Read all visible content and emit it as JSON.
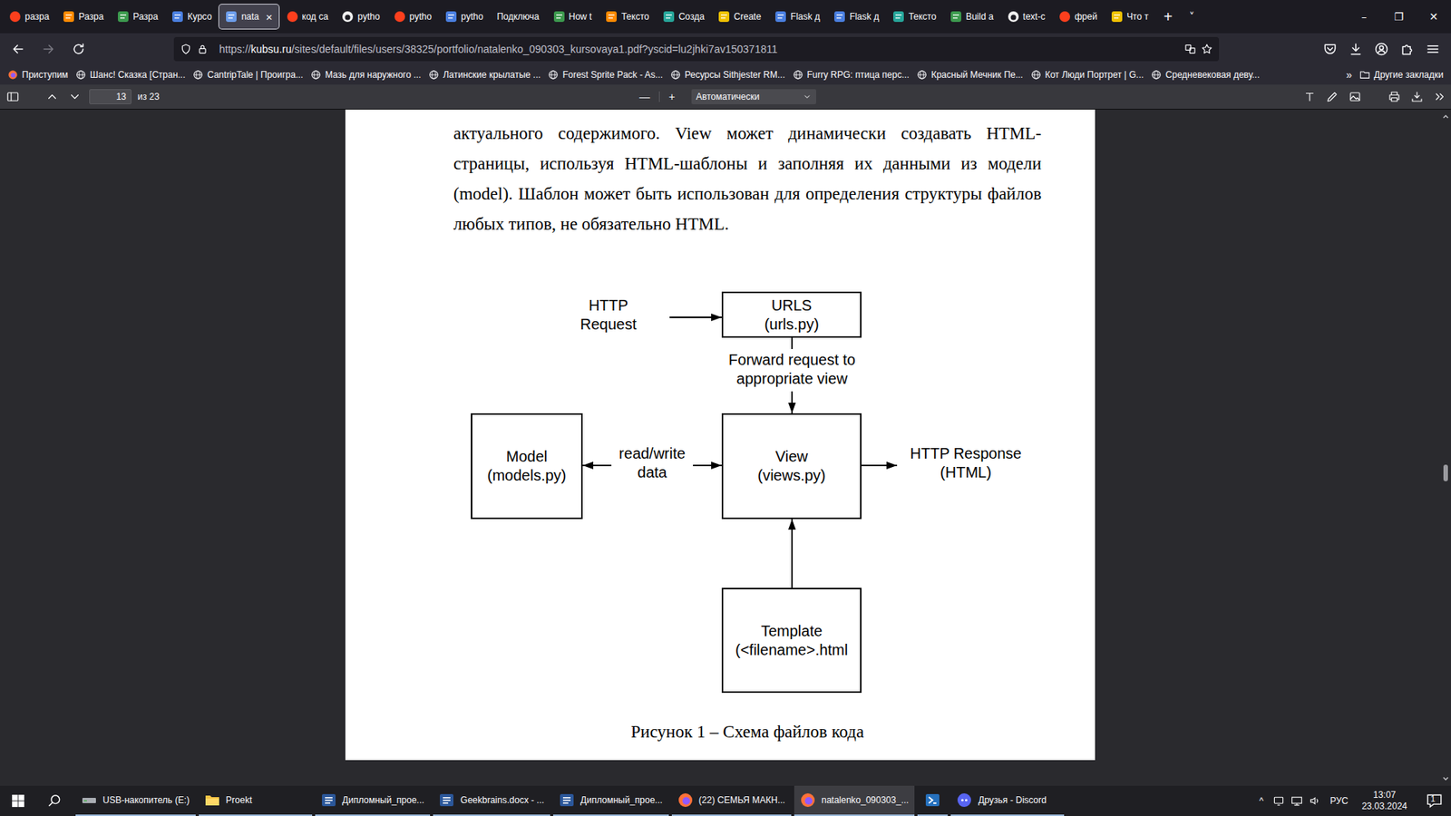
{
  "browser": {
    "tabs": [
      {
        "label": "разра",
        "kind": "yandex",
        "selected": false
      },
      {
        "label": "Разра",
        "kind": "orange",
        "selected": false
      },
      {
        "label": "Разра",
        "kind": "green",
        "selected": false
      },
      {
        "label": "Курсо",
        "kind": "blue",
        "selected": false
      },
      {
        "label": "nata",
        "kind": "pdf",
        "selected": true
      },
      {
        "label": "код са",
        "kind": "yandex",
        "selected": false
      },
      {
        "label": "pytho",
        "kind": "github",
        "selected": false
      },
      {
        "label": "pytho",
        "kind": "yandex",
        "selected": false
      },
      {
        "label": "pytho",
        "kind": "blue",
        "selected": false
      },
      {
        "label": "Подключа",
        "kind": "none",
        "selected": false
      },
      {
        "label": "How t",
        "kind": "green",
        "selected": false
      },
      {
        "label": "Тексто",
        "kind": "orange",
        "selected": false
      },
      {
        "label": "Созда",
        "kind": "teal",
        "selected": false
      },
      {
        "label": "Create",
        "kind": "yellow",
        "selected": false
      },
      {
        "label": "Flask д",
        "kind": "blue",
        "selected": false
      },
      {
        "label": "Flask д",
        "kind": "blue",
        "selected": false
      },
      {
        "label": "Тексто",
        "kind": "teal",
        "selected": false
      },
      {
        "label": "Build a",
        "kind": "green",
        "selected": false
      },
      {
        "label": "text-c",
        "kind": "github",
        "selected": false
      },
      {
        "label": "фрей",
        "kind": "yandex",
        "selected": false
      },
      {
        "label": "Что т",
        "kind": "yellow",
        "selected": false
      }
    ],
    "close_tab": "×",
    "new_tab": "+",
    "list_tabs": "˅",
    "window_controls": [
      "–",
      "❐",
      "✕"
    ],
    "back_enabled": true,
    "forward_enabled": false,
    "url": {
      "scheme": "https://",
      "host": "kubsu.ru",
      "path": "/sites/default/files/users/38325/portfolio/natalenko_090303_kursovaya1.pdf?yscid=lu2jhki7av150371811"
    },
    "bookmarks": [
      {
        "label": "Приступим",
        "kind": "firefox"
      },
      {
        "label": "Шанс! Сказка [Стран...",
        "kind": "globe"
      },
      {
        "label": "CantripTale | Проигра...",
        "kind": "globe"
      },
      {
        "label": "Мазь для наружного ...",
        "kind": "globe"
      },
      {
        "label": "Латинские крылатые ...",
        "kind": "globe"
      },
      {
        "label": "Forest Sprite Pack - As...",
        "kind": "globe"
      },
      {
        "label": "Ресурсы Sithjester RM...",
        "kind": "globe"
      },
      {
        "label": "Furry RPG: птица перс...",
        "kind": "globe"
      },
      {
        "label": "Красный Мечник Пе...",
        "kind": "globe"
      },
      {
        "label": "Кот Люди Портрет | G...",
        "kind": "globe"
      },
      {
        "label": "Средневековая деву...",
        "kind": "globe"
      }
    ],
    "bookmarks_more": "»",
    "other_bookmarks": "Другие закладки"
  },
  "pdf_toolbar": {
    "page": "13",
    "page_count": "из 23",
    "zoom_out": "—",
    "zoom_in": "+",
    "zoom": "Автоматически"
  },
  "document": {
    "lines": [
      "актуального содержимого. View может динамически создавать HTML-",
      "страницы, используя HTML-шаблоны и заполняя их данными из модели",
      "(model). Шаблон может быть использован для определения структуры файлов",
      "любых типов, не обязательно HTML."
    ],
    "figure": {
      "request": {
        "kind": "label",
        "lines": [
          "HTTP",
          "Request"
        ]
      },
      "urls": {
        "kind": "box",
        "lines": [
          "URLS",
          "(urls.py)"
        ]
      },
      "forward": {
        "kind": "label",
        "lines": [
          "Forward request to",
          "appropriate view"
        ]
      },
      "model": {
        "kind": "box",
        "lines": [
          "Model",
          "(models.py)"
        ]
      },
      "data_flow": {
        "kind": "label",
        "lines": [
          "read/write",
          "data"
        ]
      },
      "view": {
        "kind": "box",
        "lines": [
          "View",
          "(views.py)"
        ]
      },
      "response": {
        "kind": "label",
        "lines": [
          "HTTP Response",
          "(HTML)"
        ]
      },
      "template": {
        "kind": "box",
        "lines": [
          "Template",
          "(<filename>.html"
        ]
      }
    },
    "caption": "Рисунок 1 – Схема файлов кода",
    "scroll": {
      "level": 0.54
    }
  },
  "taskbar": {
    "items": [
      {
        "label": "USB-накопитель (E:)",
        "kind": "drive",
        "active": false
      },
      {
        "label": "Proekt",
        "kind": "folder",
        "active": false
      },
      {
        "label": "Дипломный_прое...",
        "kind": "word",
        "active": false
      },
      {
        "label": "Geekbrains.docx - ...",
        "kind": "word",
        "active": false
      },
      {
        "label": "Дипломный_прое...",
        "kind": "word",
        "active": false
      },
      {
        "label": "(22) СЕМЬЯ МАКН...",
        "kind": "firefox",
        "active": false
      },
      {
        "label": "natalenko_090303_...",
        "kind": "firefox",
        "active": true
      },
      {
        "kind": "powershell",
        "active": false
      },
      {
        "label": "Друзья - Discord",
        "kind": "discord",
        "active": false
      }
    ],
    "tray": {
      "overflow": "^",
      "language": "РУС",
      "time": "13:07",
      "date": "23.03.2024",
      "notifications": "1"
    }
  }
}
